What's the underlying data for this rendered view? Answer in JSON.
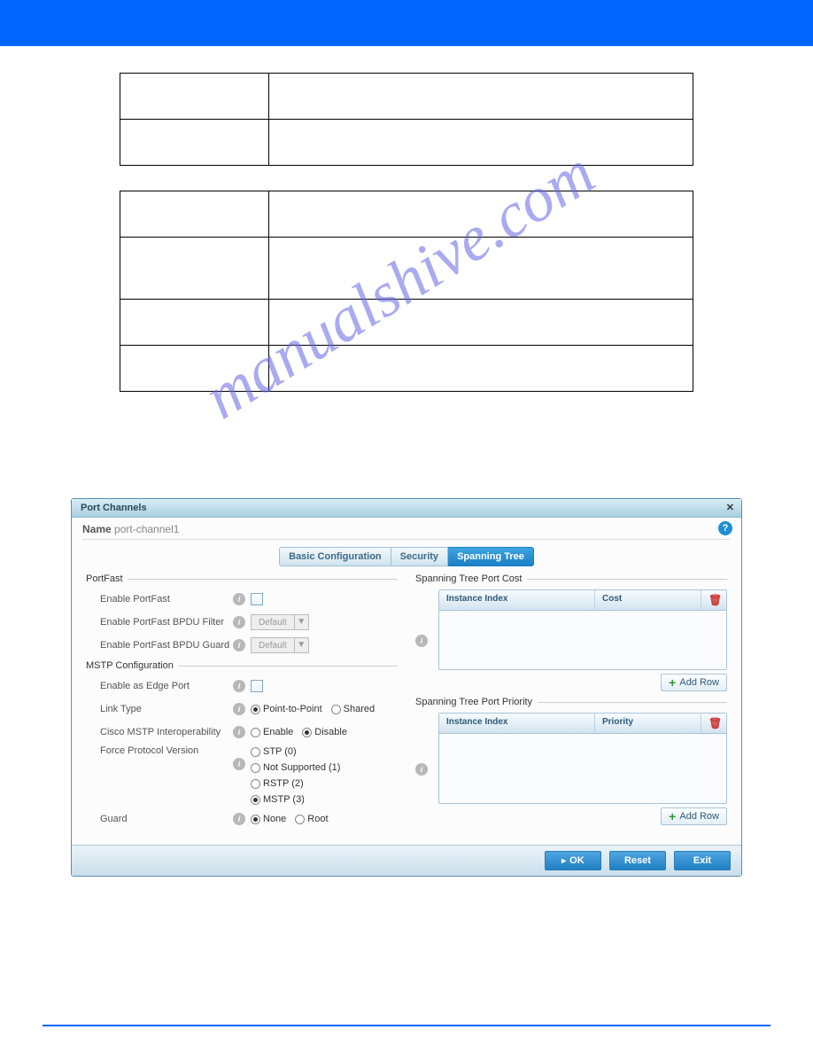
{
  "dialog": {
    "title": "Port Channels",
    "name_label": "Name",
    "name_value": "port-channel1",
    "tabs": {
      "basic": "Basic Configuration",
      "security": "Security",
      "spanning": "Spanning Tree"
    }
  },
  "portfast": {
    "legend": "PortFast",
    "enable": "Enable PortFast",
    "filter": "Enable PortFast BPDU Filter",
    "guard": "Enable PortFast BPDU Guard",
    "default": "Default"
  },
  "mstp": {
    "legend": "MSTP Configuration",
    "edge": "Enable as Edge Port",
    "linktype": "Link Type",
    "lt_p2p": "Point-to-Point",
    "lt_shared": "Shared",
    "interop": "Cisco MSTP Interoperability",
    "io_enable": "Enable",
    "io_disable": "Disable",
    "force": "Force Protocol Version",
    "fp_stp": "STP (0)",
    "fp_ns": "Not Supported (1)",
    "fp_rstp": "RSTP (2)",
    "fp_mstp": "MSTP (3)",
    "guard": "Guard",
    "g_none": "None",
    "g_root": "Root"
  },
  "grids": {
    "cost": {
      "legend": "Spanning Tree Port Cost",
      "c1": "Instance Index",
      "c2": "Cost"
    },
    "priority": {
      "legend": "Spanning Tree Port Priority",
      "c1": "Instance Index",
      "c2": "Priority"
    },
    "addrow": "Add Row"
  },
  "buttons": {
    "ok": "OK",
    "reset": "Reset",
    "exit": "Exit"
  }
}
